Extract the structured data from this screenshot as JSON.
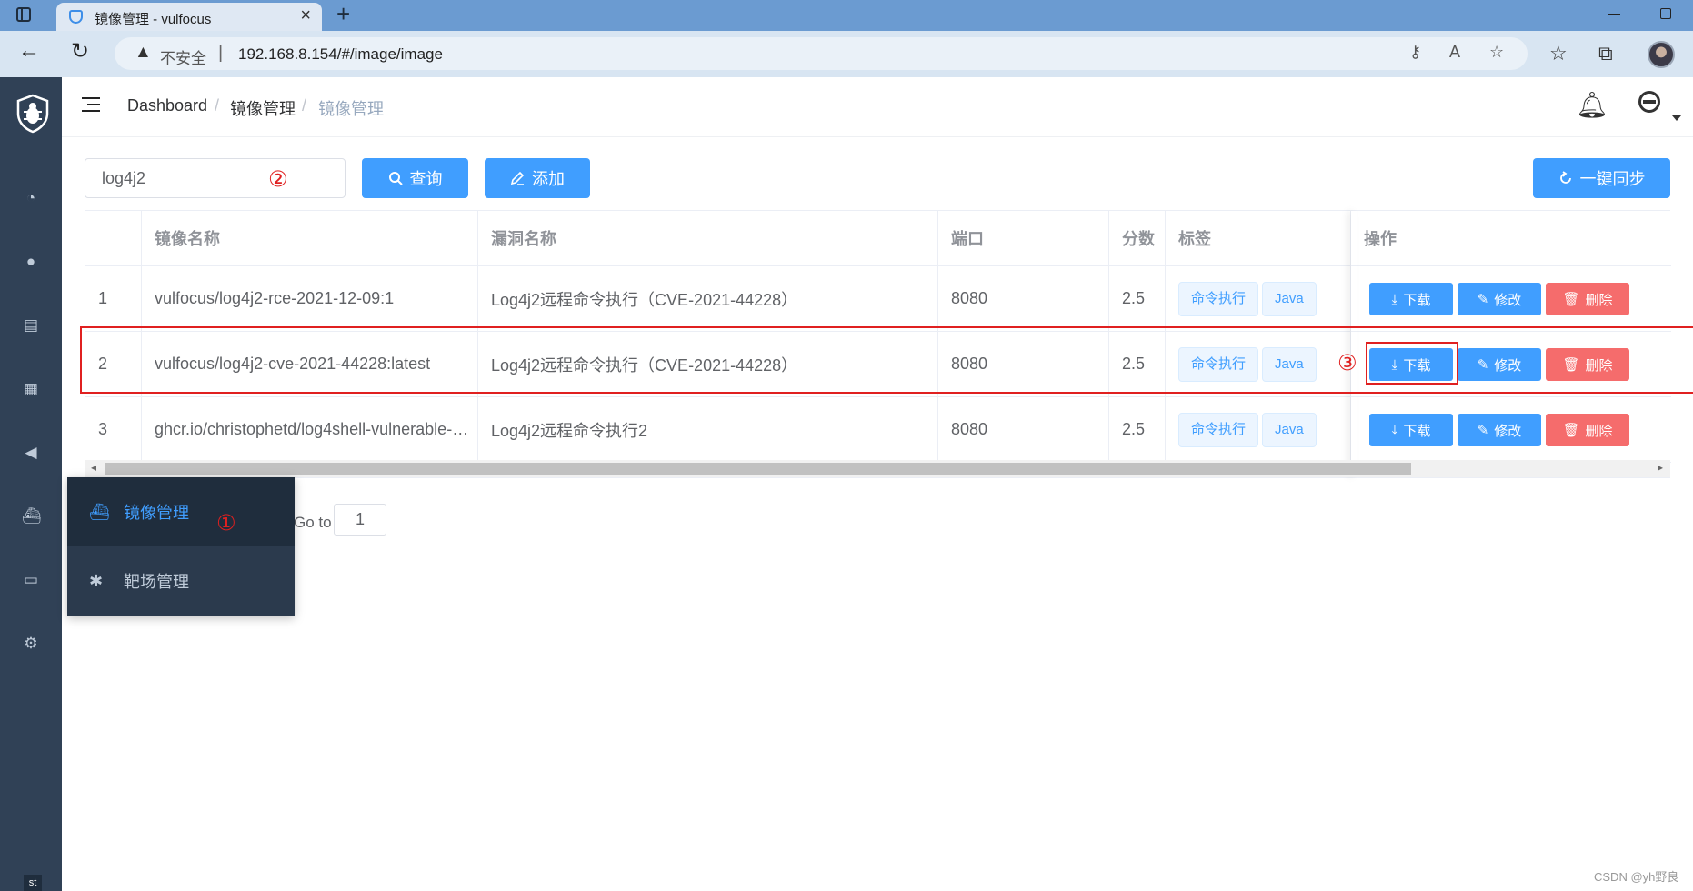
{
  "browser": {
    "tab_title": "镜像管理 - vulfocus",
    "insecure_label": "不安全",
    "url": "192.168.8.154/#/image/image",
    "separator": "|"
  },
  "header": {
    "breadcrumb": [
      "Dashboard",
      "镜像管理",
      "镜像管理"
    ],
    "breadcrumb_sep": "/"
  },
  "toolbar": {
    "search_value": "log4j2",
    "query_label": "查询",
    "add_label": "添加",
    "sync_label": "一键同步"
  },
  "table": {
    "columns": [
      "",
      "镜像名称",
      "漏洞名称",
      "端口",
      "分数",
      "标签",
      "操作"
    ],
    "rows": [
      {
        "index": "1",
        "image": "vulfocus/log4j2-rce-2021-12-09:1",
        "vuln": "Log4j2远程命令执行（CVE-2021-44228）",
        "port": "8080",
        "score": "2.5",
        "tags": [
          "命令执行",
          "Java"
        ]
      },
      {
        "index": "2",
        "image": "vulfocus/log4j2-cve-2021-44228:latest",
        "vuln": "Log4j2远程命令执行（CVE-2021-44228）",
        "port": "8080",
        "score": "2.5",
        "tags": [
          "命令执行",
          "Java"
        ]
      },
      {
        "index": "3",
        "image": "ghcr.io/christophetd/log4shell-vulnerable-…",
        "vuln": "Log4j2远程命令执行2",
        "port": "8080",
        "score": "2.5",
        "tags": [
          "命令执行",
          "Java"
        ]
      }
    ],
    "actions": {
      "download": "下载",
      "edit": "修改",
      "delete": "删除"
    }
  },
  "pagination": {
    "goto_label": "Go to",
    "page": "1"
  },
  "popup_menu": {
    "items": [
      "镜像管理",
      "靶场管理"
    ],
    "active_color": "#409eff"
  },
  "annotations": [
    "①",
    "②",
    "③"
  ],
  "sidebar": {
    "bottom_label": "st"
  },
  "watermark": "CSDN @yh野良",
  "colors": {
    "primary": "#409eff",
    "danger": "#f56c6c",
    "sidebar": "#304156",
    "annotation": "#e02020"
  }
}
